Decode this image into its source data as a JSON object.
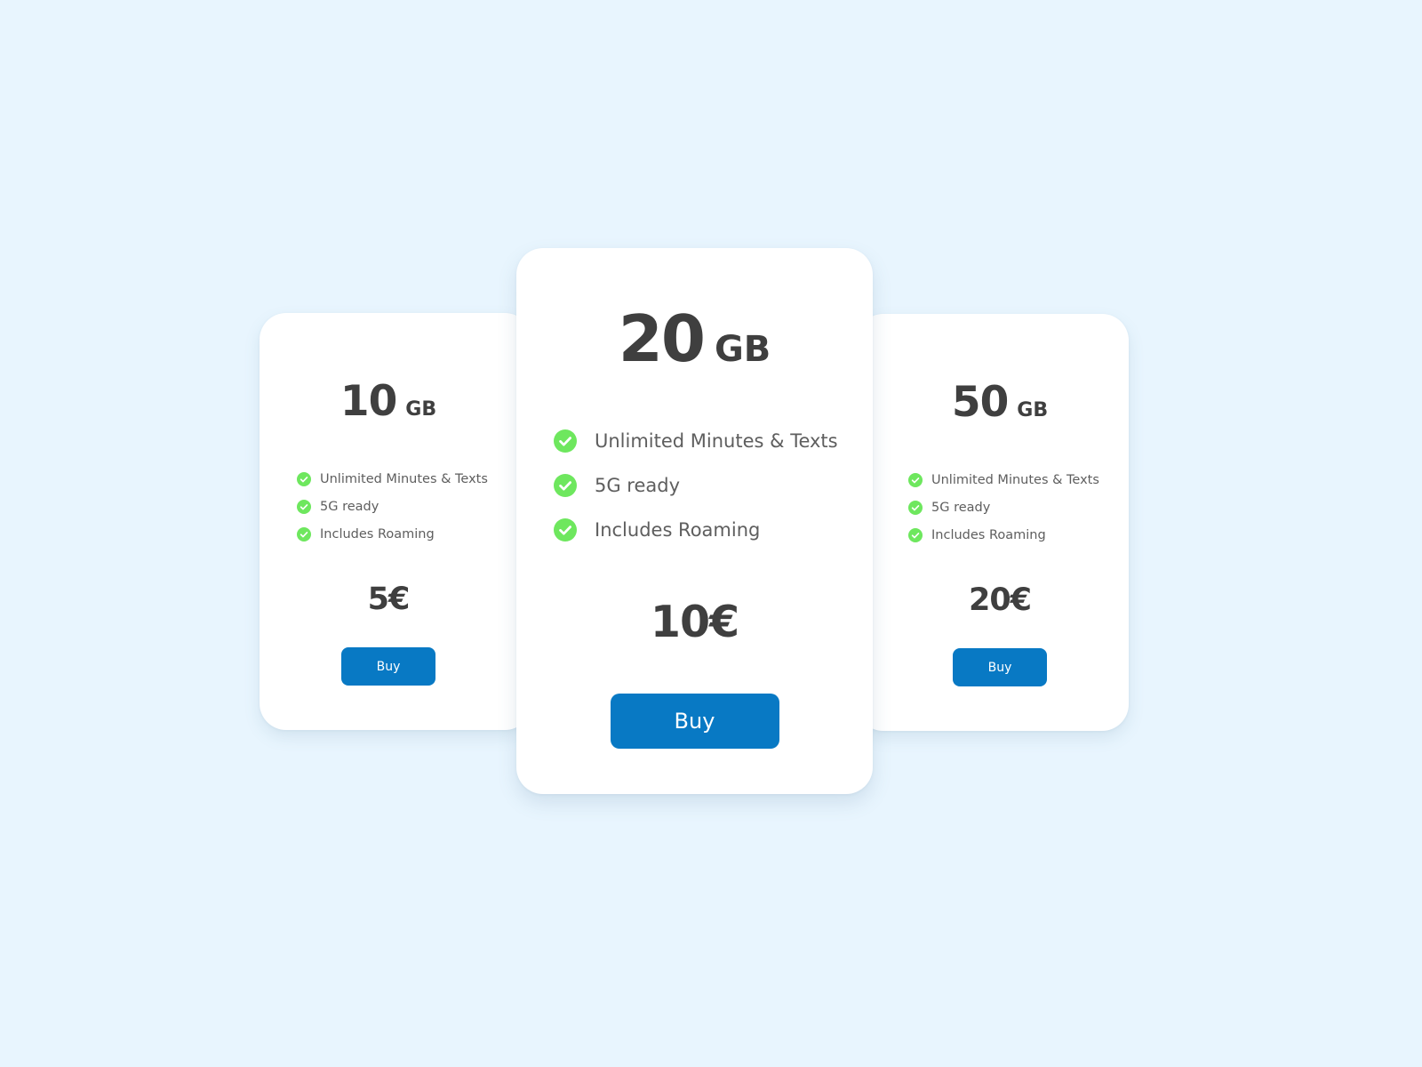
{
  "colors": {
    "background": "#e8f5fe",
    "card": "#ffffff",
    "accent_button": "#0879c4",
    "check": "#6ee75e",
    "heading_text": "#3f3f3f",
    "feature_text": "#5e5e5e"
  },
  "plans": [
    {
      "capacity_value": "10",
      "capacity_unit": "GB",
      "features": [
        {
          "icon": "check-circle-icon",
          "label": "Unlimited Minutes & Texts"
        },
        {
          "icon": "check-circle-icon",
          "label": "5G ready"
        },
        {
          "icon": "check-circle-icon",
          "label": "Includes Roaming"
        }
      ],
      "price": "5€",
      "button_label": "Buy"
    },
    {
      "capacity_value": "20",
      "capacity_unit": "GB",
      "features": [
        {
          "icon": "check-circle-icon",
          "label": "Unlimited Minutes & Texts"
        },
        {
          "icon": "check-circle-icon",
          "label": "5G ready"
        },
        {
          "icon": "check-circle-icon",
          "label": "Includes Roaming"
        }
      ],
      "price": "10€",
      "button_label": "Buy"
    },
    {
      "capacity_value": "50",
      "capacity_unit": "GB",
      "features": [
        {
          "icon": "check-circle-icon",
          "label": "Unlimited Minutes & Texts"
        },
        {
          "icon": "check-circle-icon",
          "label": "5G ready"
        },
        {
          "icon": "check-circle-icon",
          "label": "Includes Roaming"
        }
      ],
      "price": "20€",
      "button_label": "Buy"
    }
  ]
}
